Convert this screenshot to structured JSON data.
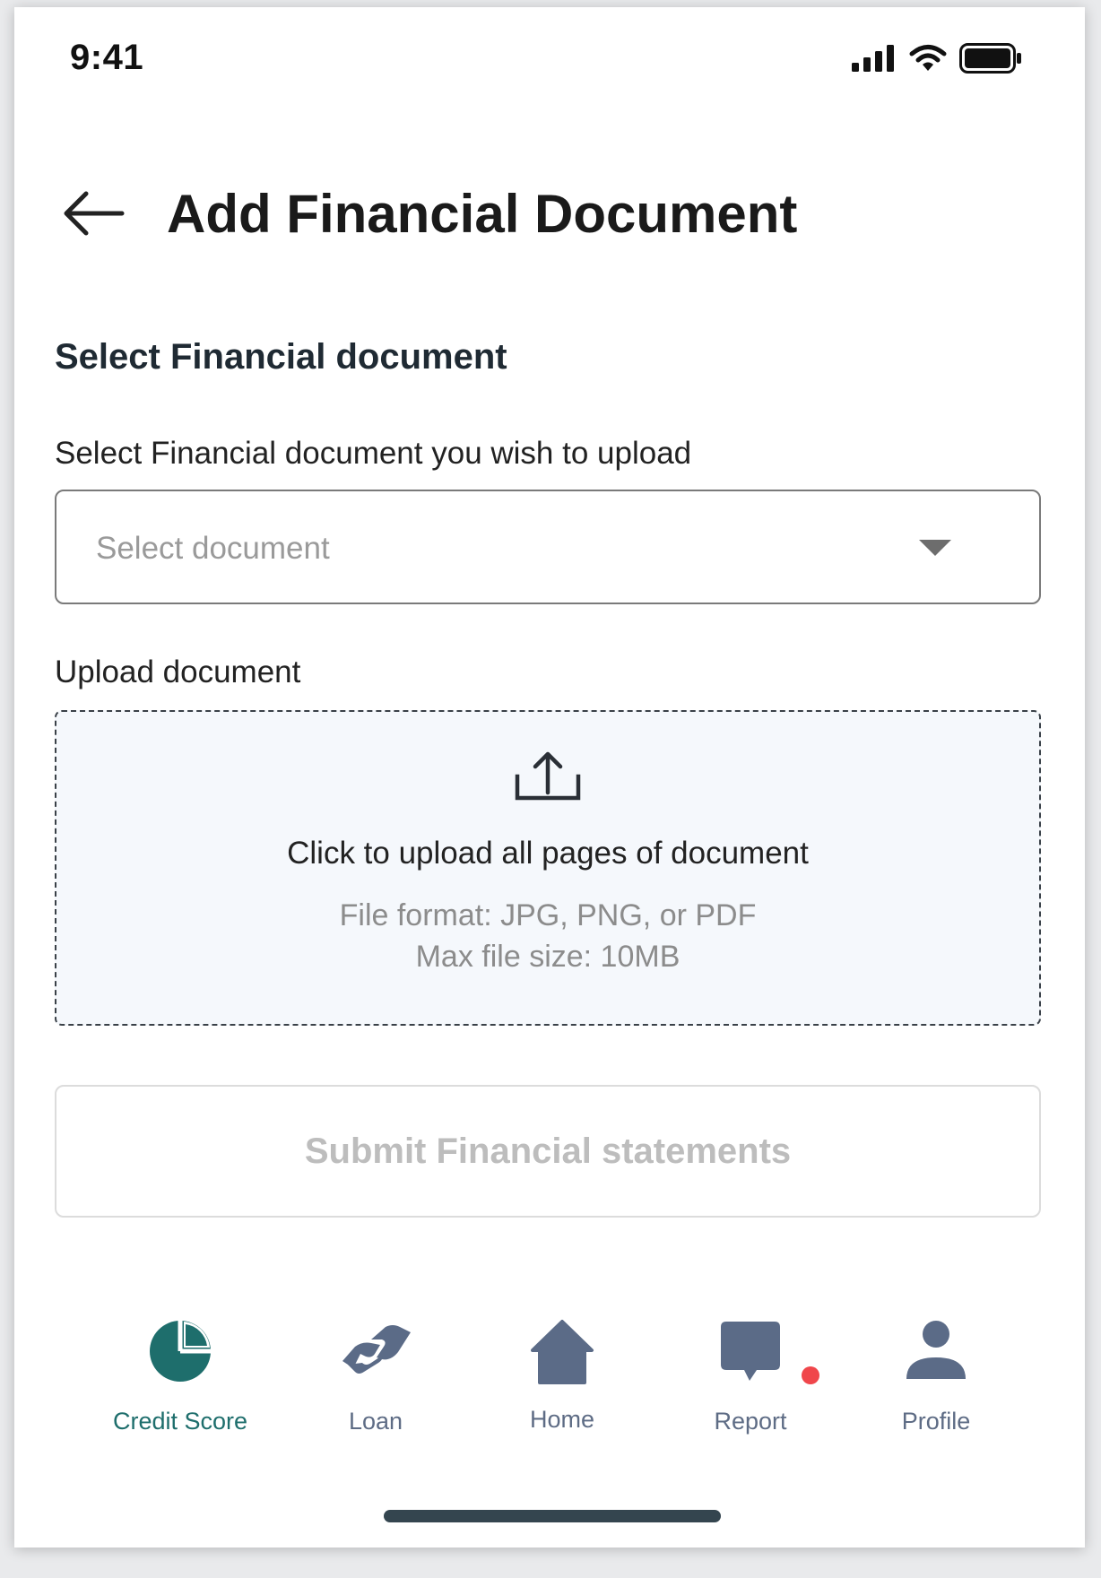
{
  "status_bar": {
    "time": "9:41",
    "icons": [
      "signal-icon",
      "wifi-icon",
      "battery-icon"
    ]
  },
  "header": {
    "back_icon": "arrow-left-icon",
    "title": "Add Financial Document"
  },
  "form": {
    "section_title": "Select Financial document",
    "document_select": {
      "label": "Select Financial document you wish to upload",
      "placeholder": "Select document",
      "value": ""
    },
    "upload": {
      "label": "Upload document",
      "icon": "upload-icon",
      "title": "Click to upload all pages of document",
      "format_hint": "File format: JPG, PNG, or PDF",
      "size_hint": "Max file size: 10MB"
    },
    "submit_label": "Submit Financial statements"
  },
  "bottom_nav": {
    "items": [
      {
        "label": "Credit Score",
        "icon": "pie-chart-icon",
        "active": true
      },
      {
        "label": "Loan",
        "icon": "handshake-icon",
        "active": false
      },
      {
        "label": "Home",
        "icon": "home-icon",
        "active": false
      },
      {
        "label": "Report",
        "icon": "chat-bubble-icon",
        "active": false,
        "notification": true
      },
      {
        "label": "Profile",
        "icon": "user-icon",
        "active": false
      }
    ]
  },
  "colors": {
    "accent": "#1e6e6c",
    "nav_icon": "#5b6b87",
    "notification": "#f0464b",
    "upload_bg": "#f5f8fc"
  }
}
